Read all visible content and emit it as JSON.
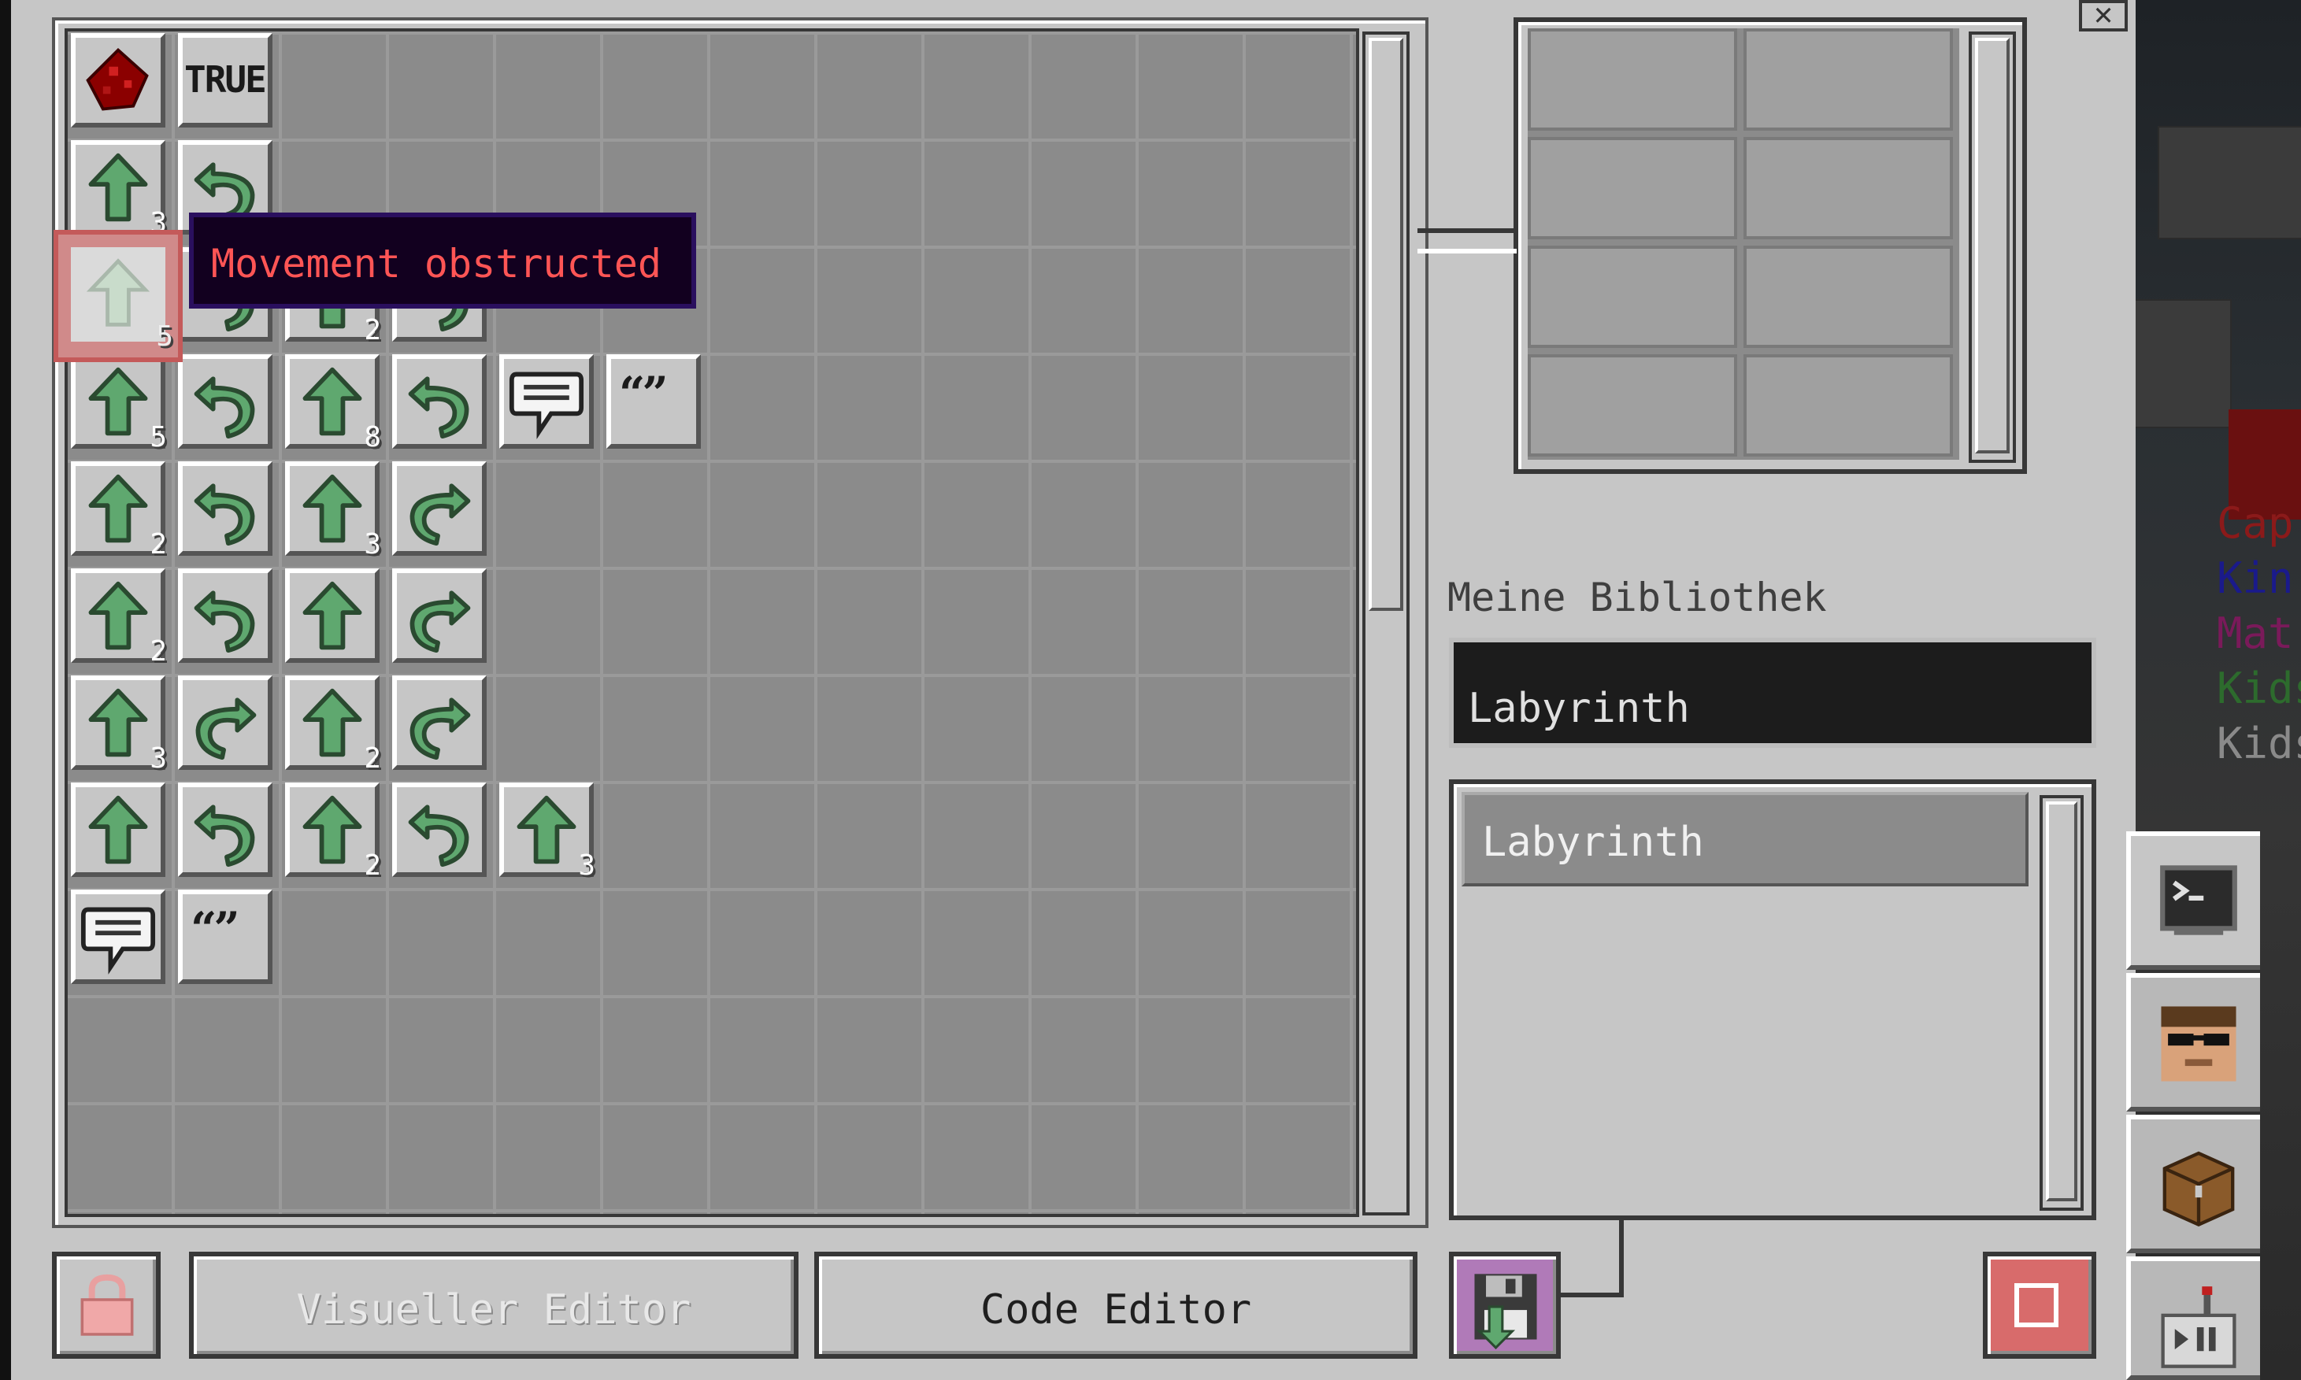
{
  "tooltip": {
    "text": "Movement obstructed"
  },
  "grid": {
    "true_label": "TRUE",
    "quote_label": "“”",
    "counts": {
      "r1c0": "3",
      "r2c0": "5",
      "r2c2": "2",
      "r3c0": "5",
      "r3c2": "8",
      "r4c0": "2",
      "r4c2": "3",
      "r5c0": "2",
      "r6c0": "3",
      "r6c2": "2",
      "r7c2": "2",
      "r7c4": "3"
    }
  },
  "library": {
    "title": "Meine Bibliothek",
    "search_value": "Labyrinth",
    "items": [
      {
        "label": "Labyrinth"
      }
    ]
  },
  "bottom": {
    "visual_editor_label": "Visueller Editor",
    "code_editor_label": "Code Editor"
  },
  "chat": {
    "lines": [
      {
        "text": "Cap",
        "color": "#8b1a1a"
      },
      {
        "text": "Kin",
        "color": "#1a1a8b"
      },
      {
        "text": "Mat",
        "color": "#7a1a5a"
      },
      {
        "text": "Kids",
        "color": "#2d6b2d"
      },
      {
        "text": "Kids",
        "color": "#8a8a8a"
      }
    ]
  },
  "colors": {
    "arrow_green": "#5fa86f",
    "arrow_outline": "#2a4a30",
    "tooltip_text": "#ff5555",
    "stop_red": "#d86b6b",
    "save_purple": "#b07ab8"
  }
}
